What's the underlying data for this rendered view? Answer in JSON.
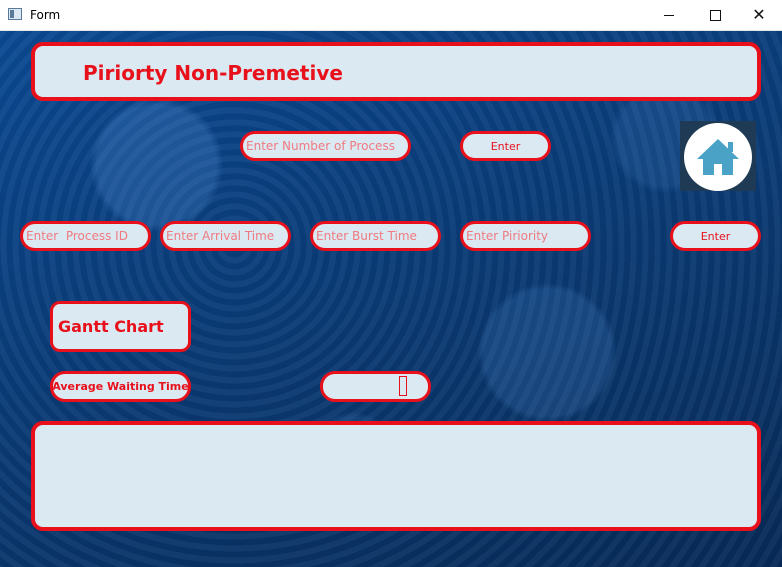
{
  "window": {
    "title": "Form"
  },
  "header": {
    "title": "Piriorty Non-Premetive"
  },
  "process_count": {
    "placeholder": "Enter Number of Process",
    "enter_label": "Enter"
  },
  "process_form": {
    "id_placeholder": "Enter  Process ID",
    "arrival_placeholder": "Enter Arrival Time",
    "burst_placeholder": "Enter Burst Time",
    "priority_placeholder": "Enter Piriority",
    "enter_label": "Enter"
  },
  "gantt": {
    "label": "Gantt Chart"
  },
  "waiting": {
    "label": "Average Waiting Time",
    "value": ""
  },
  "icons": {
    "home": "home-icon"
  },
  "colors": {
    "accent": "#e8111b",
    "panel": "#dbe9f2",
    "background": "#0a3d7a",
    "home_icon": "#4aa3c6"
  }
}
